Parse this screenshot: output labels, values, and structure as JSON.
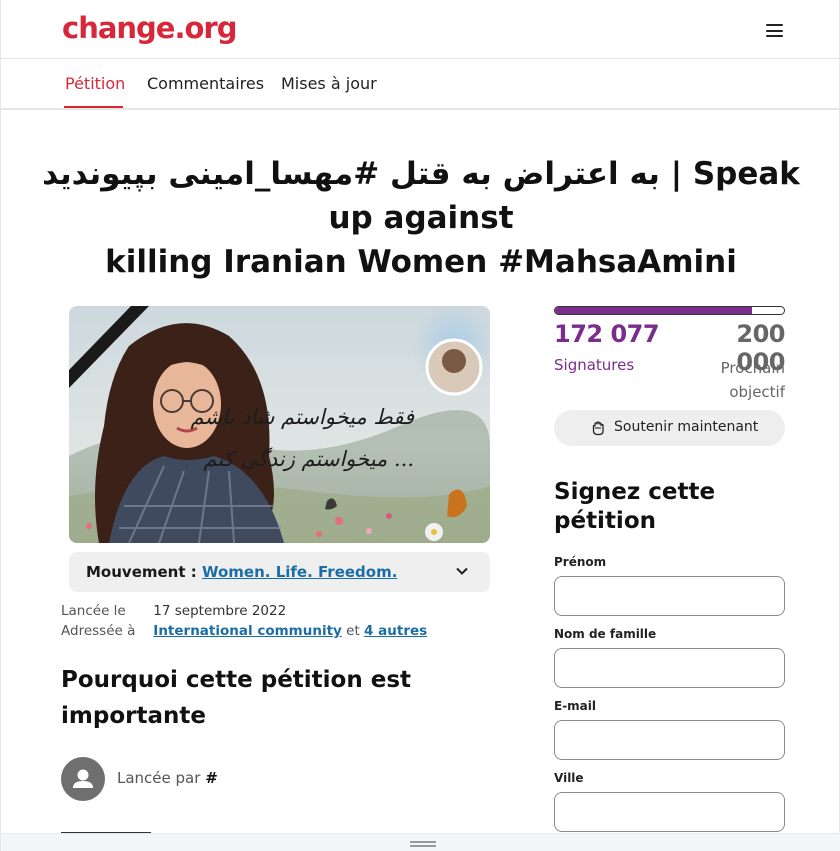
{
  "header": {
    "logo": "change.org",
    "menu_icon": "hamburger-menu-icon"
  },
  "tabs": [
    {
      "label": "Pétition",
      "active": true
    },
    {
      "label": "Commentaires",
      "active": false
    },
    {
      "label": "Mises à jour",
      "active": false
    }
  ],
  "petition": {
    "title_line1": "به اعتراض به قتل #مهسا_امینی بپیوندید | Speak up against",
    "title_line2": "killing Iranian Women #MahsaAmini",
    "image_text_line1": "فقط میخواستم شاد باشم",
    "image_text_line2": "میخواستم زندگی کنم ...",
    "movement_label": "Mouvement :",
    "movement_link": "Women. Life. Freedom.",
    "launched_key": "Lancée le",
    "launched_value": "17 septembre 2022",
    "addressed_key": "Adressée à",
    "addressed_link": "International community",
    "addressed_and": "et",
    "addressed_others": "4 autres",
    "why_heading": "Pourquoi cette pétition est importante",
    "started_by": "Lancée par",
    "started_by_name": "#"
  },
  "signatures": {
    "count": "172 077",
    "count_label": "Signatures",
    "goal": "200 000",
    "goal_label": "Prochain objectif",
    "progress_fraction": 0.86,
    "support_button": "Soutenir maintenant"
  },
  "form": {
    "heading": "Signez cette pétition",
    "fields": [
      {
        "label": "Prénom",
        "value": ""
      },
      {
        "label": "Nom de famille",
        "value": ""
      },
      {
        "label": "E-mail",
        "value": ""
      },
      {
        "label": "Ville",
        "value": ""
      }
    ]
  },
  "colors": {
    "brand": "#d7283b",
    "signature_purple": "#7a2d8a",
    "link_blue": "#1a6ea5"
  }
}
